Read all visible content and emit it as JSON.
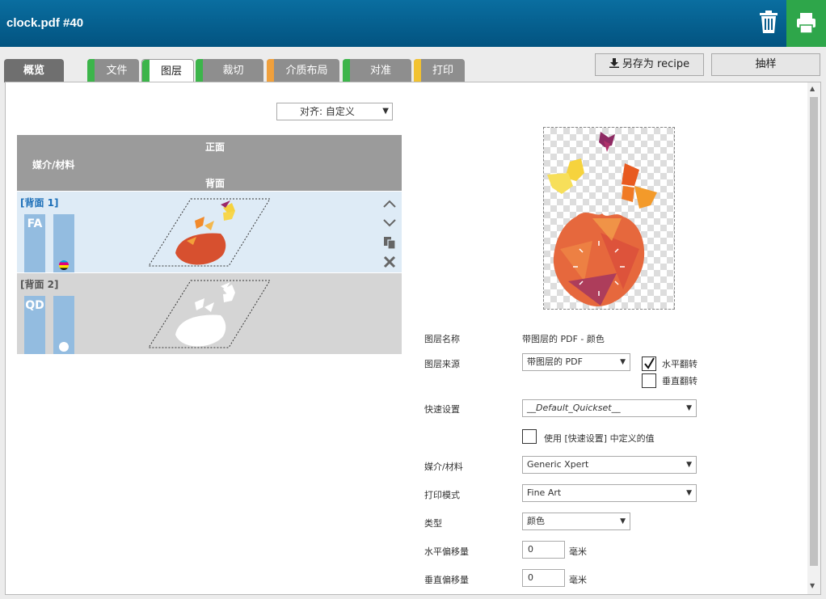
{
  "app": {
    "title": "clock.pdf #40"
  },
  "tabs": [
    {
      "label": "概览",
      "stripe": ""
    },
    {
      "label": "文件",
      "stripe": "#3cb54a"
    },
    {
      "label": "图层",
      "stripe": "#3cb54a"
    },
    {
      "label": "裁切",
      "stripe": "#3cb54a"
    },
    {
      "label": "介质布局",
      "stripe": "#f0a03c"
    },
    {
      "label": "对准",
      "stripe": "#3cb54a"
    },
    {
      "label": "打印",
      "stripe": "#f2c230"
    }
  ],
  "toolbar": {
    "save_recipe": "另存为 recipe",
    "sample": "抽样"
  },
  "align": {
    "value": "对齐: 自定义"
  },
  "layer_table": {
    "header_front": "正面",
    "header_media": "媒介/材料",
    "header_back": "背面",
    "layers": [
      {
        "name": "[背面 1]",
        "code": "FA"
      },
      {
        "name": "[背面 2]",
        "code": "QD"
      }
    ]
  },
  "properties": {
    "layer_name_label": "图层名称",
    "layer_name_value": "带图层的 PDF - 颜色",
    "layer_source_label": "图层来源",
    "layer_source_value": "带图层的 PDF",
    "flip_h_label": "水平翻转",
    "flip_h_checked": true,
    "flip_v_label": "垂直翻转",
    "flip_v_checked": false,
    "quickset_label": "快速设置",
    "quickset_value": "__Default_Quickset__",
    "use_quickset_label": "使用 [快速设置] 中定义的值",
    "use_quickset_checked": false,
    "media_label": "媒介/材料",
    "media_value": "Generic Xpert",
    "print_mode_label": "打印模式",
    "print_mode_value": "Fine Art",
    "type_label": "类型",
    "type_value": "颜色",
    "h_offset_label": "水平偏移量",
    "h_offset_value": "0",
    "h_offset_unit": "毫米",
    "v_offset_label": "垂直偏移量",
    "v_offset_value": "0",
    "v_offset_unit": "毫米"
  },
  "colors": {
    "topbar": "#025380",
    "print_button": "#2ea64a",
    "tab_gray": "#8e8e8e",
    "layer_active_bg": "#deebf6",
    "layer_bar": "#93bce0",
    "layer_name_active": "#1c6fb8"
  },
  "icons": {
    "trash": "trash-icon",
    "print": "printer-icon",
    "download": "download-icon",
    "move_up": "chevron-up-icon",
    "move_down": "chevron-down-icon",
    "duplicate": "duplicate-icon",
    "delete": "delete-icon"
  }
}
